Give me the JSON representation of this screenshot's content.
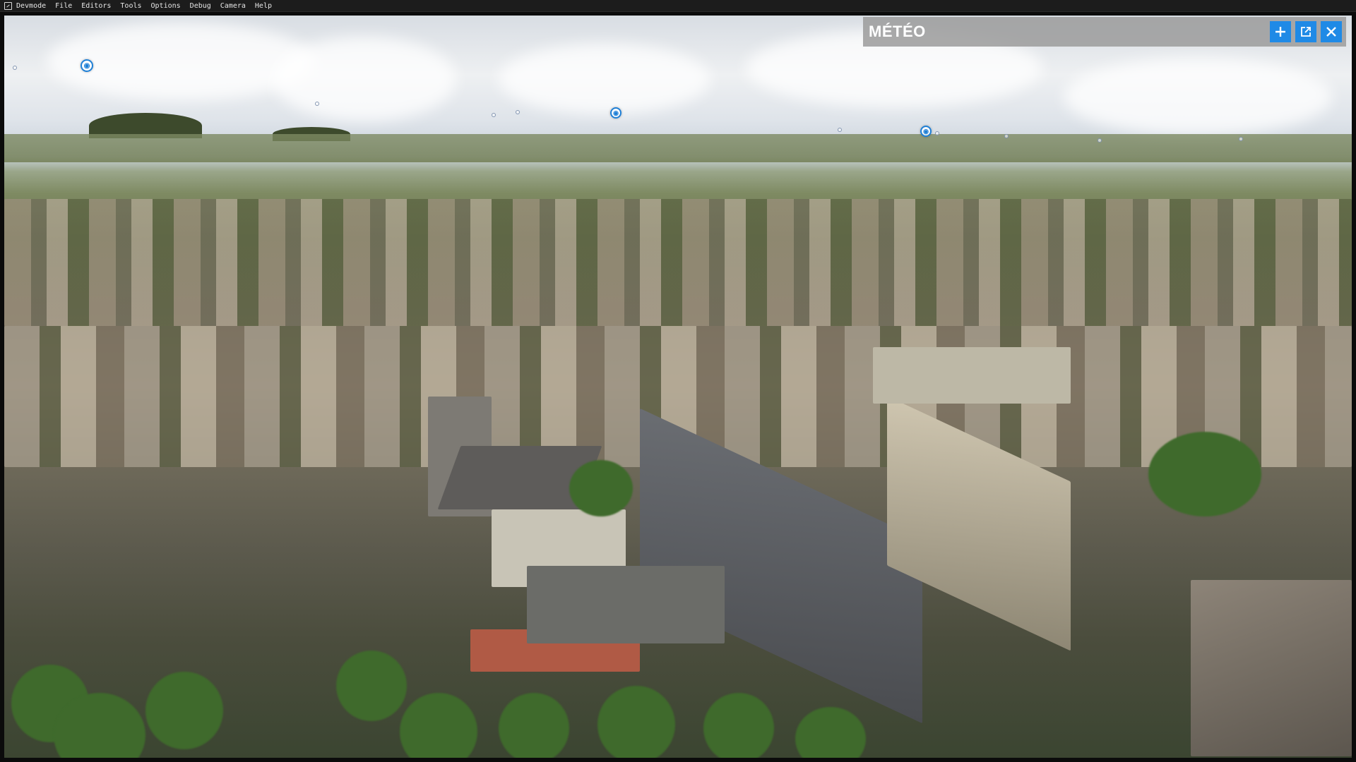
{
  "menubar": {
    "items": [
      "Devmode",
      "File",
      "Editors",
      "Tools",
      "Options",
      "Debug",
      "Camera",
      "Help"
    ]
  },
  "weather_panel": {
    "title": "MÉTÉO",
    "buttons": [
      {
        "name": "add-button",
        "icon": "plus-icon"
      },
      {
        "name": "undock-button",
        "icon": "external-window-icon"
      },
      {
        "name": "close-button",
        "icon": "close-icon"
      }
    ],
    "accent_color": "#1f8ae6"
  },
  "viewport": {
    "scene": "aerial-city-view",
    "poi_marker_icon": "map-pin-icon"
  }
}
